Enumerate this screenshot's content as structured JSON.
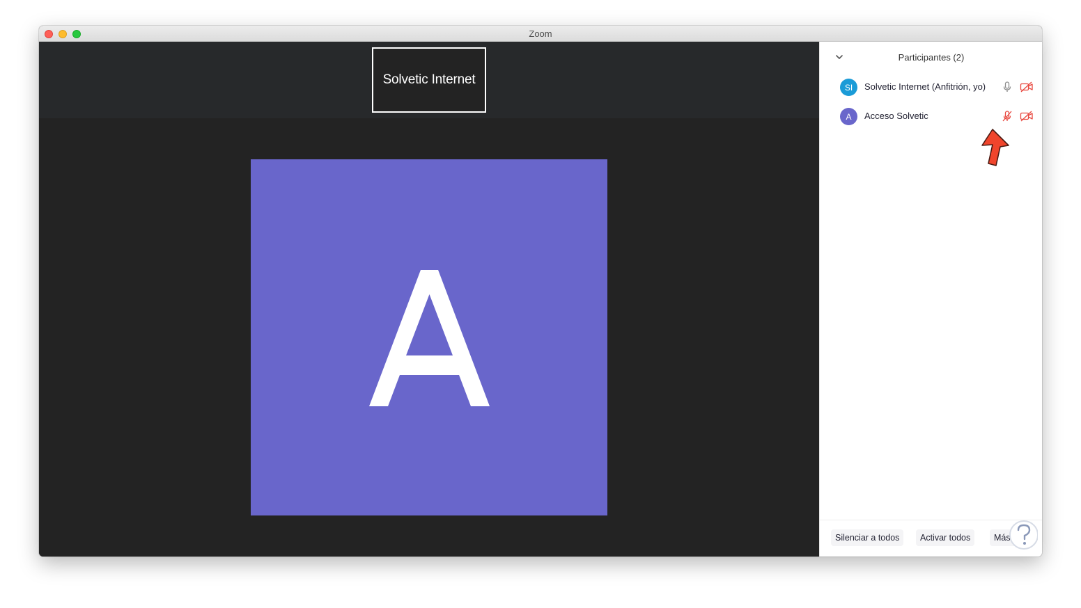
{
  "window": {
    "title": "Zoom"
  },
  "video": {
    "thumbnail_label": "Solvetic Internet",
    "speaker_initial": "A",
    "speaker_color": "#6966cb"
  },
  "participants_panel": {
    "title": "Participantes (2)",
    "participants": [
      {
        "initials": "SI",
        "name": "Solvetic Internet (Anfitrión, yo)",
        "avatar_color": "#1a9bd7",
        "mic": "mic-on-icon",
        "video": "video-off-icon"
      },
      {
        "initials": "A",
        "name": "Acceso Solvetic",
        "avatar_color": "#6966cb",
        "mic": "mic-muted-icon",
        "video": "video-off-icon"
      }
    ],
    "footer": {
      "mute_all": "Silenciar a todos",
      "unmute_all": "Activar todos",
      "more": "Más"
    }
  },
  "colors": {
    "muted_red": "#e8473e",
    "arrow_red": "#f0452c"
  }
}
